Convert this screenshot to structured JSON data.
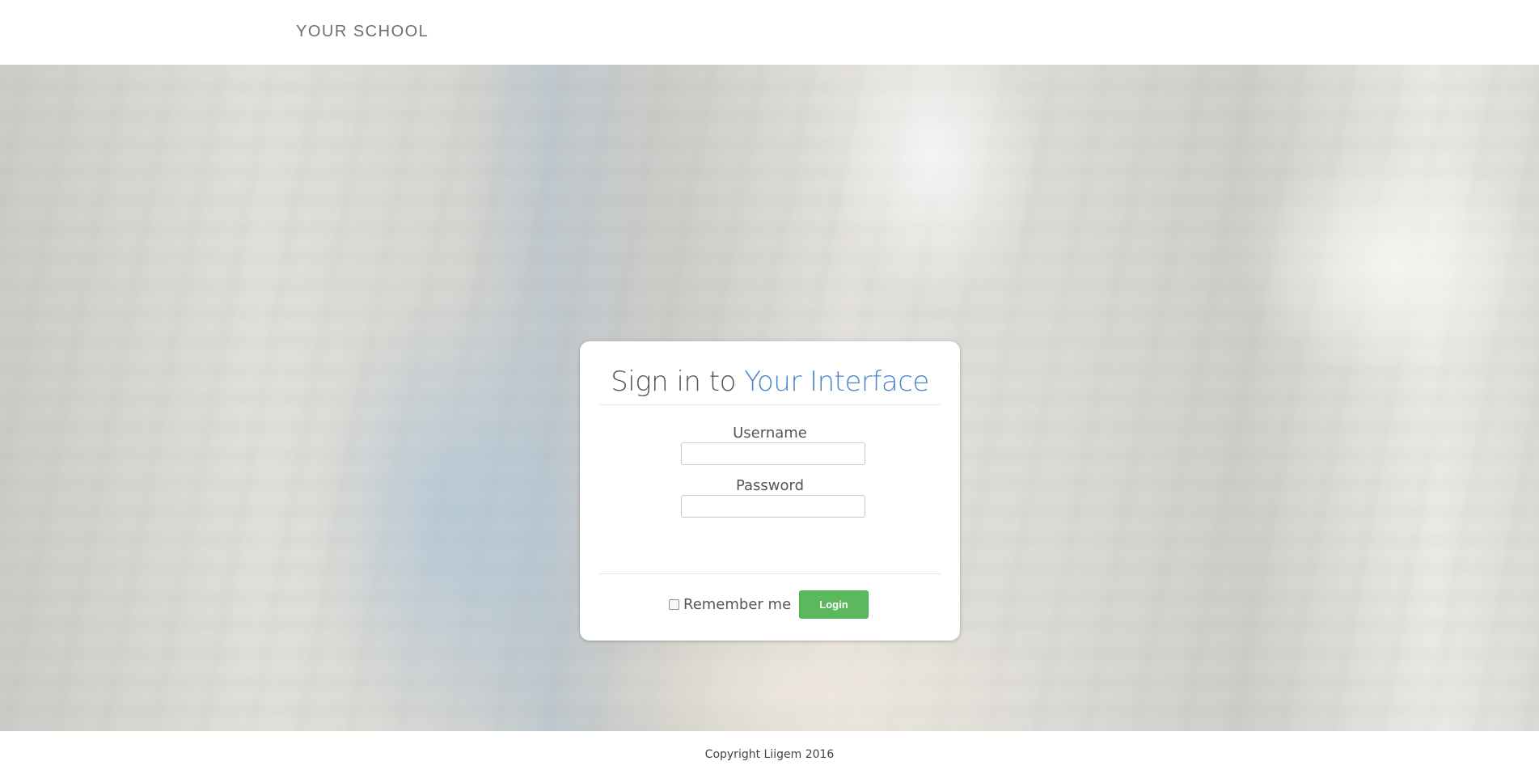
{
  "header": {
    "brand": "YOUR SCHOOL"
  },
  "login": {
    "title_prefix": "Sign in to",
    "title_accent": "Your Interface",
    "username_label": "Username",
    "username_value": "",
    "password_label": "Password",
    "password_value": "",
    "remember_label": "Remember me",
    "remember_checked": false,
    "login_button": "Login"
  },
  "footer": {
    "copyright": "Copyright Liigem 2016"
  },
  "colors": {
    "accent_blue": "#4a86c8",
    "login_green": "#5cb85c",
    "text_gray": "#555555"
  },
  "background": {
    "image_subject": "blurred glass dome interior with visitors"
  }
}
